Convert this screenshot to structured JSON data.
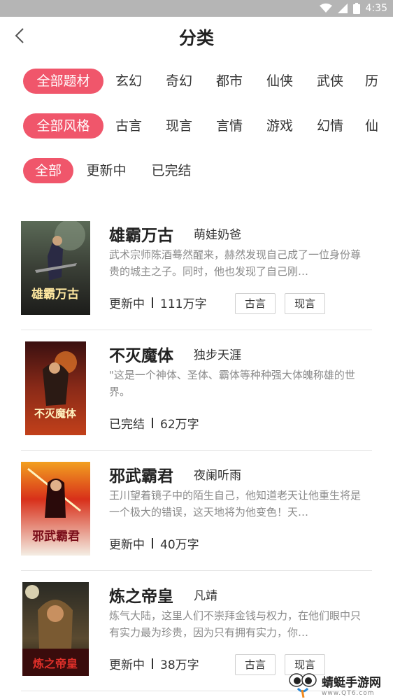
{
  "status_bar": {
    "time": "4:35"
  },
  "header": {
    "title": "分类"
  },
  "filters": {
    "subject": [
      "全部题材",
      "玄幻",
      "奇幻",
      "都市",
      "仙侠",
      "武侠",
      "历"
    ],
    "style": [
      "全部风格",
      "古言",
      "现言",
      "言情",
      "游戏",
      "幻情",
      "仙"
    ],
    "status": [
      "全部",
      "更新中",
      "已完结"
    ]
  },
  "books": [
    {
      "title": "雄霸万古",
      "author": "萌娃奶爸",
      "desc": "武术宗师陈酒蓦然醒来，赫然发现自己成了一位身份尊贵的城主之子。同时，他也发现了自己刚…",
      "status": "更新中",
      "words": "111万字",
      "tags": [
        "古言",
        "现言"
      ],
      "cover_text": "雄霸万古"
    },
    {
      "title": "不灭魔体",
      "author": "独步天涯",
      "desc": "\"这是一个神体、圣体、霸体等种种强大体魄称雄的世界。",
      "status": "已完结",
      "words": "62万字",
      "tags": [],
      "cover_text": "不灭魔体"
    },
    {
      "title": "邪武霸君",
      "author": "夜阑听雨",
      "desc": "王川望着镜子中的陌生自己，他知道老天让他重生将是一个极大的错误，这天地将为他变色！天…",
      "status": "更新中",
      "words": "40万字",
      "tags": [],
      "cover_text": "邪武霸君"
    },
    {
      "title": "炼之帝皇",
      "author": "凡靖",
      "desc": "炼气大陆，这里人们不崇拜金钱与权力，在他们眼中只有实力最为珍贵，因为只有拥有实力，你…",
      "status": "更新中",
      "words": "38万字",
      "tags": [
        "古言",
        "现言"
      ],
      "cover_text": "炼之帝皇"
    }
  ],
  "watermark": {
    "name": "蜻蜓手游网",
    "url": "www.QT6.com"
  },
  "colors": {
    "accent": "#f0566b",
    "status_bar": "#b5b5b5"
  }
}
